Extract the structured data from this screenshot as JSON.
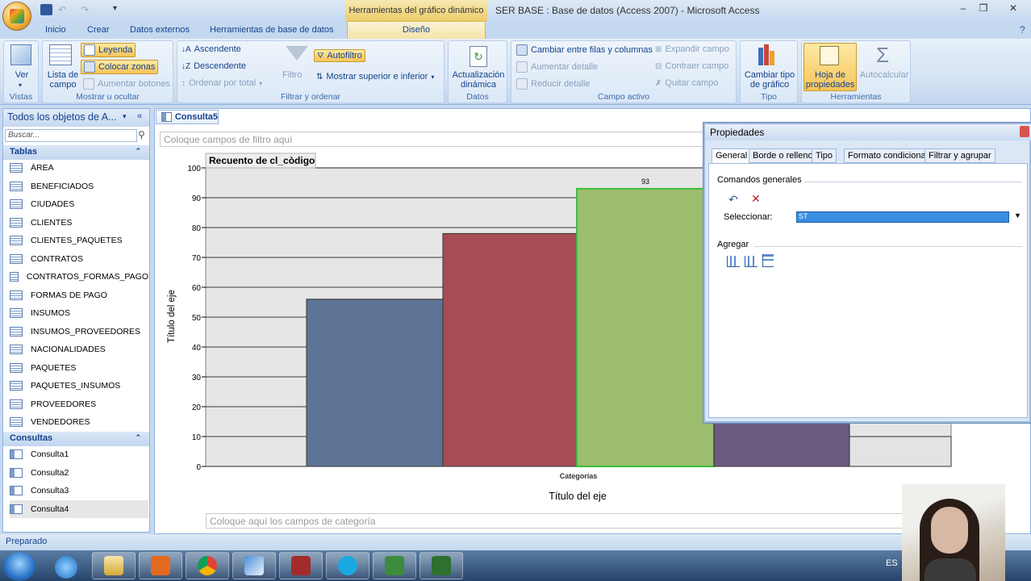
{
  "window": {
    "contextual_tab_group": "Herramientas del gráfico dinámico",
    "title": "SER BASE : Base de datos (Access 2007) - Microsoft Access"
  },
  "ribbon_tabs": [
    "Inicio",
    "Crear",
    "Datos externos",
    "Herramientas de base de datos",
    "Diseño"
  ],
  "ribbon": {
    "vistas": {
      "label": "Vistas",
      "ver": "Ver"
    },
    "mostrar": {
      "label": "Mostrar u ocultar",
      "lista_campo": "Lista de\ncampo",
      "leyenda": "Leyenda",
      "colocar_zonas": "Colocar zonas",
      "aumentar_botones": "Aumentar botones"
    },
    "filtrar": {
      "label": "Filtrar y ordenar",
      "ascendente": "Ascendente",
      "descendente": "Descendente",
      "ordenar_total": "Ordenar por total",
      "filtro": "Filtro",
      "autofiltro": "Autofiltro",
      "mostrar_superior": "Mostrar superior e inferior"
    },
    "datos": {
      "label": "Datos",
      "actualizacion": "Actualización\ndinámica"
    },
    "campo_activo": {
      "label": "Campo activo",
      "cambiar_filas": "Cambiar entre filas y columnas",
      "aumentar_detalle": "Aumentar detalle",
      "reducir_detalle": "Reducir detalle",
      "expandir": "Expandir campo",
      "contraer": "Contraer campo",
      "quitar": "Quitar campo"
    },
    "tipo": {
      "label": "Tipo",
      "cambiar_tipo": "Cambiar tipo\nde gráfico"
    },
    "herramientas": {
      "label": "Herramientas",
      "hoja_prop": "Hoja de\npropiedades",
      "autocalcular": "Autocalcular"
    }
  },
  "nav": {
    "header": "Todos los objetos de A...",
    "search_placeholder": "Buscar...",
    "tables_label": "Tablas",
    "tables": [
      "ÀREA",
      "BENEFICIADOS",
      "CIUDADES",
      "CLIENTES",
      "CLIENTES_PAQUETES",
      "CONTRATOS",
      "CONTRATOS_FORMAS_PAGO",
      "FORMAS DE PAGO",
      "INSUMOS",
      "INSUMOS_PROVEEDORES",
      "NACIONALIDADES",
      "PAQUETES",
      "PAQUETES_INSUMOS",
      "PROVEEDORES",
      "VENDEDORES"
    ],
    "queries_label": "Consultas",
    "queries": [
      "Consulta1",
      "Consulta2",
      "Consulta3",
      "Consulta4"
    ]
  },
  "document": {
    "tab": "Consulta5",
    "filter_zone": "Coloque campos de filtro aquí",
    "category_zone": "Coloque aquí los campos de categoría"
  },
  "chart_data": {
    "type": "bar",
    "title": "Recuento de cl_còdigo",
    "categories": [
      "",
      "",
      "",
      "",
      ""
    ],
    "values": [
      56,
      78,
      93,
      15,
      10
    ],
    "visible_value_labels": [
      null,
      null,
      "93",
      null,
      null
    ],
    "colors": [
      "#5d7496",
      "#a54c55",
      "#9dbd6e",
      "#6b5b80",
      "#e3e3e3"
    ],
    "xlabel": "Título del eje",
    "x_tick_label": "Categorías",
    "ylabel": "Título del eje",
    "ylim": [
      0,
      100
    ],
    "yticks": [
      0,
      10,
      20,
      30,
      40,
      50,
      60,
      70,
      80,
      90,
      100
    ]
  },
  "properties": {
    "title": "Propiedades",
    "tabs": [
      "General",
      "Borde o relleno",
      "Tipo",
      "Formato condicional",
      "Filtrar y agrupar"
    ],
    "comandos": "Comandos generales",
    "seleccionar_label": "Seleccionar:",
    "seleccionar_value": "ST",
    "agregar": "Agregar"
  },
  "status": {
    "text": "Preparado"
  },
  "taskbar": {
    "language": "ES"
  },
  "colors": {
    "ribbon": "#dbe8f7",
    "highlight": "#f6c45a",
    "accent": "#15428b"
  }
}
